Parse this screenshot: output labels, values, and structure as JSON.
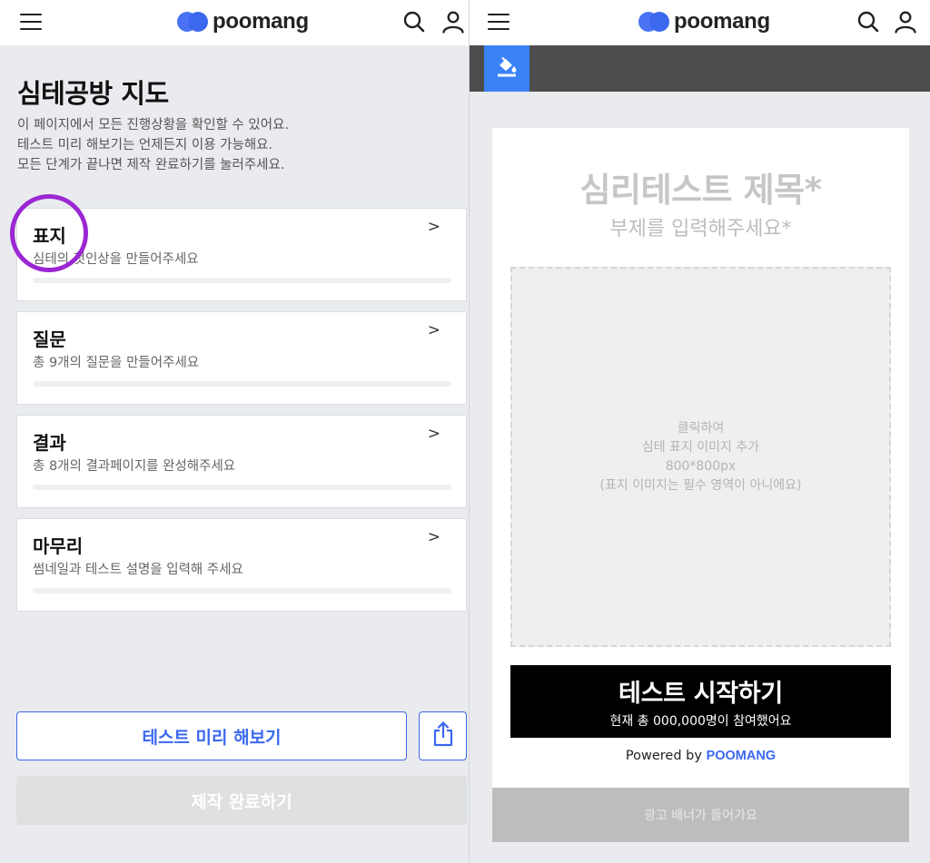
{
  "app": {
    "logo_text": "poomang",
    "brand_color": "#3b68ee",
    "annotation_color": "#9b27d3"
  },
  "left": {
    "title": "심테공방 지도",
    "description": [
      "이 페이지에서 모든 진행상황을 확인할 수 있어요.",
      "테스트 미리 해보기는 언제든지 이용 가능해요.",
      "모든 단계가 끝나면 제작 완료하기를 눌러주세요."
    ],
    "steps": [
      {
        "title": "표지",
        "subtitle": "심테의 첫인상을 만들어주세요",
        "chevron": ">",
        "progress": 0
      },
      {
        "title": "질문",
        "subtitle": "총 9개의 질문을 만들어주세요",
        "chevron": ">",
        "progress": 0
      },
      {
        "title": "결과",
        "subtitle": "총 8개의 결과페이지를 완성해주세요",
        "chevron": ">",
        "progress": 0
      },
      {
        "title": "마무리",
        "subtitle": "썸네일과 테스트 설명을 입력해 주세요",
        "chevron": ">",
        "progress": 0
      }
    ],
    "preview_button": "테스트 미리 해보기",
    "complete_button": "제작 완료하기"
  },
  "right": {
    "cover": {
      "title_placeholder": "심리테스트 제목*",
      "subtitle_placeholder": "부제를 입력해주세요*",
      "image_hint": [
        "클릭하여",
        "심테 표지 이미지 추가",
        "800*800px",
        "(표지 이미지는 필수 영역이 아니에요)"
      ],
      "start_button": "테스트 시작하기",
      "participants": "현재 총 000,000명이 참여했어요",
      "powered_by": "Powered by",
      "powered_brand": "POOMANG",
      "ad_banner": "광고 배너가 들어가요"
    }
  },
  "icons": {
    "menu": "hamburger-menu-icon",
    "search": "search-icon",
    "user": "user-icon",
    "share": "share-icon",
    "paint": "paint-bucket-icon"
  }
}
